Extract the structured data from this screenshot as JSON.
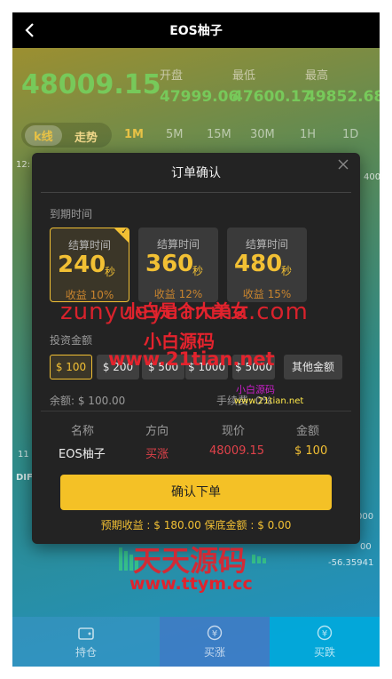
{
  "header": {
    "title": "EOS柚子"
  },
  "quote": {
    "price": "48009.15",
    "stats": [
      {
        "label": "开盘",
        "value": "47999.06"
      },
      {
        "label": "最低",
        "value": "47600.17"
      },
      {
        "label": "最高",
        "value": "49852.68"
      }
    ]
  },
  "tabs": [
    "k线",
    "走势",
    "1M",
    "5M",
    "15M",
    "30M",
    "1H",
    "1D"
  ],
  "background_fragments": {
    "left_time": "12:",
    "right_top": "400",
    "left_mid": "11",
    "left_dif": "DIF",
    "right_vals": [
      "000",
      "00",
      "-56.35941"
    ]
  },
  "bottom_nav": [
    {
      "label": "持仓",
      "icon": "wallet-icon"
    },
    {
      "label": "买涨",
      "icon": "yen-coin-icon"
    },
    {
      "label": "买跌",
      "icon": "yen-coin-icon"
    }
  ],
  "modal": {
    "title": "订单确认",
    "expiry_label": "到期时间",
    "expiry_options": [
      {
        "label": "结算时间",
        "value": "240",
        "unit": "秒",
        "profit": "收益 10%",
        "selected": true
      },
      {
        "label": "结算时间",
        "value": "360",
        "unit": "秒",
        "profit": "收益 12%",
        "selected": false
      },
      {
        "label": "结算时间",
        "value": "480",
        "unit": "秒",
        "profit": "收益 15%",
        "selected": false
      }
    ],
    "amount_label": "投资金额",
    "amounts": [
      {
        "label": "$ 100",
        "selected": true
      },
      {
        "label": "$ 200",
        "selected": false
      },
      {
        "label": "$ 500",
        "selected": false
      },
      {
        "label": "$ 1000",
        "selected": false
      },
      {
        "label": "$ 5000",
        "selected": false
      }
    ],
    "other_amount": "其他金额",
    "balance": "余额: $ 100.00",
    "fee": "手续费: 0%",
    "table_headers": [
      "名称",
      "方向",
      "现价",
      "金额"
    ],
    "table_row": [
      "EOS柚子",
      "买涨",
      "48009.15",
      "$ 100"
    ],
    "confirm_button": "确认下单",
    "summary": "预期收益 : $ 180.00    保底金额 : $ 0.00"
  },
  "watermarks": {
    "main": "zunyueyuanma.com",
    "xiaobai_1": "小白是个大美女",
    "xiaobai_2": "小白源码",
    "url_21": "www.21tian.net",
    "small_1": "小白源码",
    "small_url": "www.21tian.net",
    "ttym_1": "天天源码",
    "ttym_2": "www.ttym.cc"
  },
  "colors": {
    "accent": "#f2c034",
    "up_red": "#e0424a",
    "price_green": "#77c95a"
  }
}
